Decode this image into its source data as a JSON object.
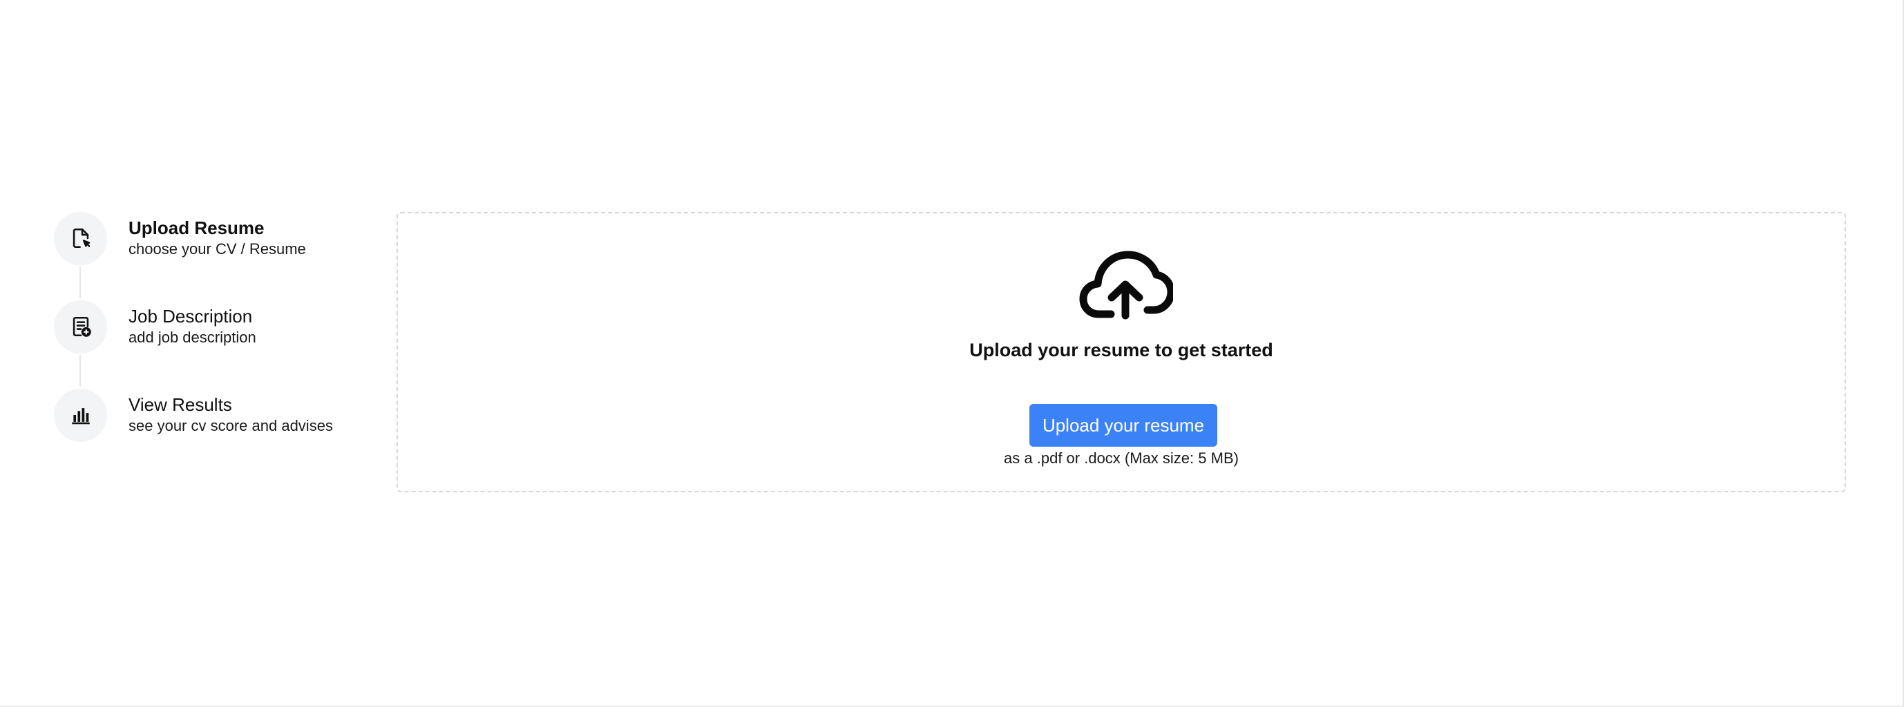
{
  "steps": [
    {
      "title": "Upload Resume",
      "subtitle": "choose your CV / Resume",
      "icon": "file-cursor-icon",
      "active": true
    },
    {
      "title": "Job Description",
      "subtitle": "add job description",
      "icon": "document-add-icon",
      "active": false
    },
    {
      "title": "View Results",
      "subtitle": "see your cv score and advises",
      "icon": "bar-chart-icon",
      "active": false
    }
  ],
  "upload": {
    "icon": "cloud-upload-icon",
    "heading": "Upload your resume to get started",
    "button_label": "Upload your resume",
    "hint": "as a .pdf or .docx (Max size: 5 MB)"
  },
  "colors": {
    "accent": "#3b82f6",
    "step_icon_bg": "#f3f4f6",
    "panel_border": "#d6d6d6"
  }
}
